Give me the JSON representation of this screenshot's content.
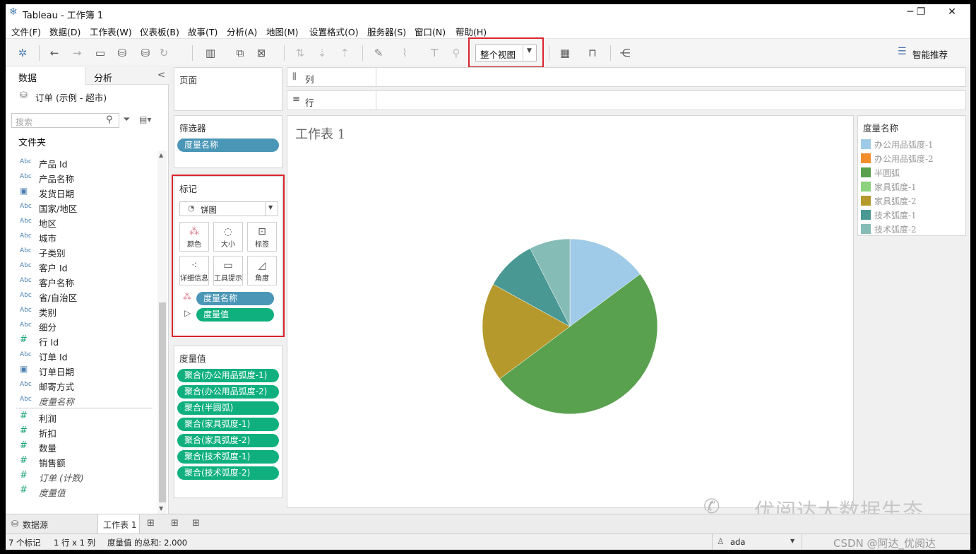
{
  "window": {
    "title": "Tableau - 工作簿 1",
    "min_label": "─",
    "max_label": "❐",
    "close_label": "✕"
  },
  "menu": [
    "文件(F)",
    "数据(D)",
    "工作表(W)",
    "仪表板(B)",
    "故事(T)",
    "分析(A)",
    "地图(M)",
    "设置格式(O)",
    "服务器(S)",
    "窗口(N)",
    "帮助(H)"
  ],
  "toolbar": {
    "fit_select": "整个视图",
    "show_me": "智能推荐"
  },
  "sidebar": {
    "tab_data": "数据",
    "tab_analysis": "分析",
    "collapse": "<",
    "datasource": "订单 (示例 - 超市)",
    "search_placeholder": "搜索",
    "folder": "文件夹",
    "dimensions": [
      {
        "type": "Abc",
        "name": "产品 Id"
      },
      {
        "type": "Abc",
        "name": "产品名称"
      },
      {
        "type": "date",
        "name": "发货日期"
      },
      {
        "type": "Abc",
        "name": "国家/地区"
      },
      {
        "type": "Abc",
        "name": "地区"
      },
      {
        "type": "Abc",
        "name": "城市"
      },
      {
        "type": "Abc",
        "name": "子类别"
      },
      {
        "type": "Abc",
        "name": "客户 Id"
      },
      {
        "type": "Abc",
        "name": "客户名称"
      },
      {
        "type": "Abc",
        "name": "省/自治区"
      },
      {
        "type": "Abc",
        "name": "类别"
      },
      {
        "type": "Abc",
        "name": "细分"
      },
      {
        "type": "#",
        "name": "行 Id"
      },
      {
        "type": "Abc",
        "name": "订单 Id"
      },
      {
        "type": "date",
        "name": "订单日期"
      },
      {
        "type": "Abc",
        "name": "邮寄方式"
      },
      {
        "type": "Abc",
        "name": "度量名称",
        "italic": true
      }
    ],
    "measures": [
      {
        "name": "利润"
      },
      {
        "name": "折扣"
      },
      {
        "name": "数量"
      },
      {
        "name": "销售额"
      },
      {
        "name": "订单 (计数)",
        "italic": true
      },
      {
        "name": "度量值",
        "italic": true
      }
    ]
  },
  "pages": {
    "title": "页面"
  },
  "columns": {
    "title": "列"
  },
  "rows": {
    "title": "行"
  },
  "filters": {
    "title": "筛选器",
    "pill": "度量名称"
  },
  "marks": {
    "title": "标记",
    "type": "饼图",
    "buttons": [
      "颜色",
      "大小",
      "标签",
      "详细信息",
      "工具提示",
      "角度"
    ],
    "color_pill": "度量名称",
    "angle_pill": "度量值"
  },
  "measure_values": {
    "title": "度量值",
    "pills": [
      "聚合(办公用品弧度-1)",
      "聚合(办公用品弧度-2)",
      "聚合(半圆弧)",
      "聚合(家具弧度-1)",
      "聚合(家具弧度-2)",
      "聚合(技术弧度-1)",
      "聚合(技术弧度-2)"
    ]
  },
  "sheet": {
    "title": "工作表 1"
  },
  "legend": {
    "title": "度量名称",
    "items": [
      {
        "label": "办公用品弧度-1",
        "color": "#a0cbe8"
      },
      {
        "label": "办公用品弧度-2",
        "color": "#f28e2b"
      },
      {
        "label": "半圆弧",
        "color": "#59a14f"
      },
      {
        "label": "家具弧度-1",
        "color": "#8cd17d"
      },
      {
        "label": "家具弧度-2",
        "color": "#b6992d"
      },
      {
        "label": "技术弧度-1",
        "color": "#499894"
      },
      {
        "label": "技术弧度-2",
        "color": "#86bcb6"
      }
    ]
  },
  "chart_data": {
    "type": "pie",
    "slices": [
      {
        "name": "办公用品弧度-1",
        "value": 0.148,
        "color": "#a0cbe8"
      },
      {
        "name": "办公用品弧度-2",
        "value": 0.0,
        "color": "#f28e2b"
      },
      {
        "name": "半圆弧",
        "value": 0.5,
        "color": "#59a14f"
      },
      {
        "name": "家具弧度-1",
        "value": 0.0,
        "color": "#8cd17d"
      },
      {
        "name": "家具弧度-2",
        "value": 0.182,
        "color": "#b6992d"
      },
      {
        "name": "技术弧度-1",
        "value": 0.095,
        "color": "#499894"
      },
      {
        "name": "技术弧度-2",
        "value": 0.075,
        "color": "#86bcb6"
      }
    ]
  },
  "tabs": {
    "datasource": "数据源",
    "sheet": "工作表 1"
  },
  "status": {
    "marks": "7 个标记",
    "rowcol": "1 行 x 1 列",
    "sum": "度量值 的总和: 2.000",
    "user": "ada"
  },
  "watermark": {
    "text": "优阅达大数据生态",
    "credit": "CSDN @阿达_优阅达"
  }
}
